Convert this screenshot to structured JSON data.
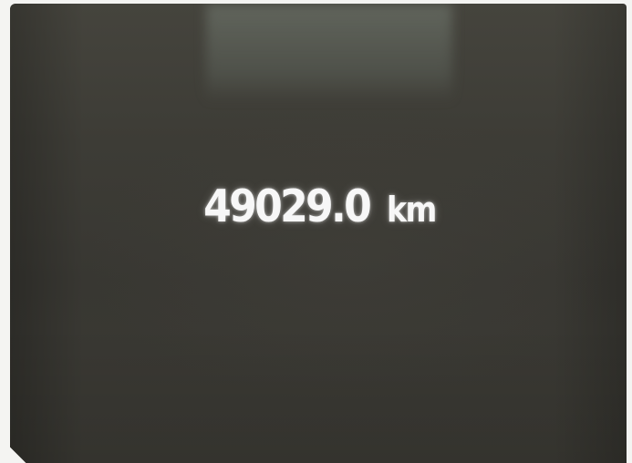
{
  "odometer": {
    "value": "49029.0",
    "unit": "km"
  },
  "colors": {
    "display_background": "#3b3a34",
    "display_text": "#f7f7f7",
    "surround": "#f4f4f2"
  }
}
